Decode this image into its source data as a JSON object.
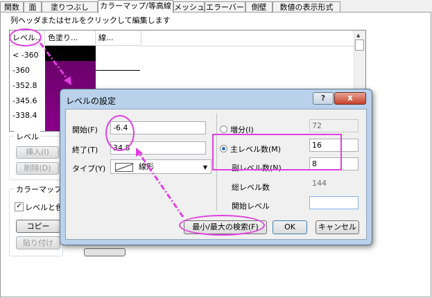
{
  "tabs": [
    "関数",
    "面",
    "塗りつぶし",
    "カラーマップ/等高線",
    "メッシュ",
    "エラーバー",
    "側壁",
    "数値の表示形式"
  ],
  "panel": {
    "hint": "列ヘッダまたはセルをクリックして編集します",
    "grid": {
      "headers": [
        "レベル..",
        "色塗り...",
        "線..."
      ],
      "rows": [
        "< -360",
        "-360",
        "-352.8",
        "-345.6",
        "-338.4"
      ]
    },
    "level_group": {
      "title": "レベル",
      "insert": "挿入(I)",
      "delete": "削除(D)"
    },
    "colormap_group": {
      "title": "カラーマップテ",
      "checkbox": "レベルと色の",
      "copy": "コピー",
      "paste": "貼り付け"
    }
  },
  "dialog": {
    "title": "レベルの設定",
    "start_label": "開始(F)",
    "start_value": "-6.4",
    "end_label": "終了(T)",
    "end_value": "34.8",
    "type_label": "タイプ(Y)",
    "type_value": "線形",
    "increment_label": "増分(I)",
    "increment_value": "72",
    "major_label": "主レベル数(M)",
    "major_value": "16",
    "minor_label": "副レベル数(N)",
    "minor_value": "8",
    "total_label": "総レベル数",
    "total_value": "144",
    "startlevel_label": "開始レベル",
    "startlevel_value": "",
    "find_minmax": "最小/最大の検索(F)",
    "ok": "OK",
    "cancel": "キャンセル",
    "help": "?",
    "close": "x"
  },
  "colors": {
    "highlight": "#e040e0",
    "colorbar_dark": "#000000",
    "colorbar_purple": "#7a007a"
  }
}
